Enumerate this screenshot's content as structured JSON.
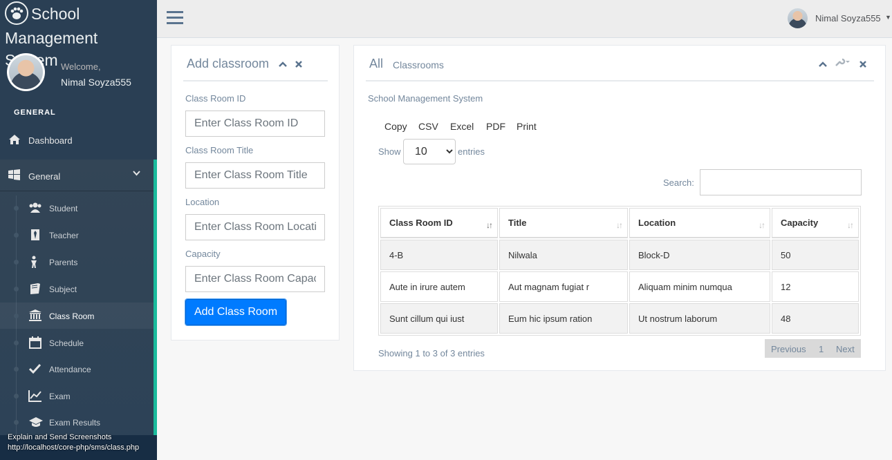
{
  "brand": {
    "title": "School Management System"
  },
  "profile": {
    "welcome": "Welcome,",
    "name": "Nimal Soyza555"
  },
  "sidebar": {
    "section_title": "GENERAL",
    "dashboard": {
      "label": "Dashboard",
      "icon": "home-icon"
    },
    "general": {
      "label": "General",
      "icon": "windows-icon"
    },
    "items": [
      {
        "label": "Student",
        "icon": "users-icon"
      },
      {
        "label": "Teacher",
        "icon": "tie-icon"
      },
      {
        "label": "Parents",
        "icon": "child-icon"
      },
      {
        "label": "Subject",
        "icon": "book-icon"
      },
      {
        "label": "Class Room",
        "icon": "institution-icon",
        "active": true
      },
      {
        "label": "Schedule",
        "icon": "calendar-icon"
      },
      {
        "label": "Attendance",
        "icon": "check-icon"
      },
      {
        "label": "Exam",
        "icon": "line-chart-icon"
      },
      {
        "label": "Exam Results",
        "icon": "graduation-cap-icon"
      }
    ]
  },
  "status_bar": {
    "line1": "Explain and Send Screenshots",
    "line2": "http://localhost/core-php/sms/class.php"
  },
  "topnav": {
    "user_name": "Nimal Soyza555"
  },
  "add_form": {
    "title": "Add classroom",
    "fields": [
      {
        "label": "Class Room ID",
        "placeholder": "Enter Class Room ID"
      },
      {
        "label": "Class Room Title",
        "placeholder": "Enter Class Room Title"
      },
      {
        "label": "Location",
        "placeholder": "Enter Class Room Location"
      },
      {
        "label": "Capacity",
        "placeholder": "Enter Class Room Capacity"
      }
    ],
    "submit_label": "Add Class Room"
  },
  "list_panel": {
    "title": "All",
    "title_small": "Classrooms",
    "subtitle": "School Management System",
    "export_buttons": [
      "Copy",
      "CSV",
      "Excel",
      "PDF",
      "Print"
    ],
    "show_label": "Show",
    "entries_label": "entries",
    "page_length": "10",
    "search_label": "Search:",
    "columns": [
      "Class Room ID",
      "Title",
      "Location",
      "Capacity"
    ],
    "rows": [
      [
        "4-B",
        "Nilwala",
        "Block-D",
        "50"
      ],
      [
        "Aute in irure autem",
        "Aut magnam fugiat r",
        "Aliquam minim numqua",
        "12"
      ],
      [
        "Sunt cillum qui iust",
        "Eum hic ipsum ration",
        "Ut nostrum laborum",
        "48"
      ]
    ],
    "info": "Showing 1 to 3 of 3 entries",
    "pager": {
      "previous": "Previous",
      "page": "1",
      "next": "Next"
    }
  },
  "colors": {
    "sidebar": "#2A3F54",
    "accent": "#1ABB9C",
    "primary_button": "#007BFF"
  }
}
